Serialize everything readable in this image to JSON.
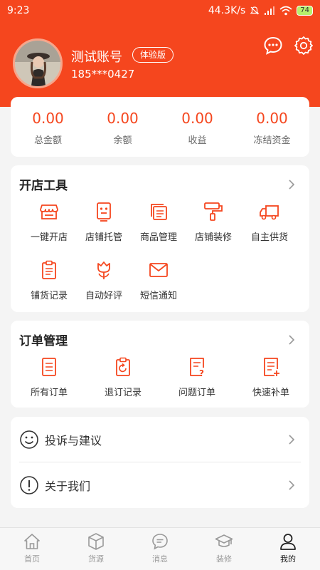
{
  "status_bar": {
    "time": "9:23",
    "network_speed": "44.3K/s",
    "battery": "74"
  },
  "profile": {
    "name": "测试账号",
    "badge": "体验版",
    "phone": "185***0427"
  },
  "stats": [
    {
      "value": "0.00",
      "label": "总金额"
    },
    {
      "value": "0.00",
      "label": "余额"
    },
    {
      "value": "0.00",
      "label": "收益"
    },
    {
      "value": "0.00",
      "label": "冻结资金"
    }
  ],
  "shop_tools": {
    "title": "开店工具",
    "items": [
      {
        "label": "一键开店",
        "icon": "store-icon"
      },
      {
        "label": "店铺托管",
        "icon": "robot-icon"
      },
      {
        "label": "商品管理",
        "icon": "stack-icon"
      },
      {
        "label": "店铺装修",
        "icon": "paint-roller-icon"
      },
      {
        "label": "自主供货",
        "icon": "truck-icon"
      },
      {
        "label": "铺货记录",
        "icon": "clipboard-icon"
      },
      {
        "label": "自动好评",
        "icon": "tulip-icon"
      },
      {
        "label": "短信通知",
        "icon": "envelope-icon"
      }
    ]
  },
  "orders": {
    "title": "订单管理",
    "items": [
      {
        "label": "所有订单",
        "icon": "document-icon"
      },
      {
        "label": "退订记录",
        "icon": "refund-icon"
      },
      {
        "label": "问题订单",
        "icon": "question-doc-icon"
      },
      {
        "label": "快速补单",
        "icon": "add-doc-icon"
      }
    ]
  },
  "links": [
    {
      "label": "投诉与建议",
      "icon": "smile-icon"
    },
    {
      "label": "关于我们",
      "icon": "info-icon"
    }
  ],
  "tabs": [
    {
      "label": "首页",
      "icon": "home-icon"
    },
    {
      "label": "货源",
      "icon": "box-icon"
    },
    {
      "label": "消息",
      "icon": "message-icon"
    },
    {
      "label": "装修",
      "icon": "graduation-cap-icon"
    },
    {
      "label": "我的",
      "icon": "person-icon"
    }
  ],
  "colors": {
    "brand": "#f5461e",
    "background": "#f4f4f4",
    "active_tab": "#222222"
  }
}
